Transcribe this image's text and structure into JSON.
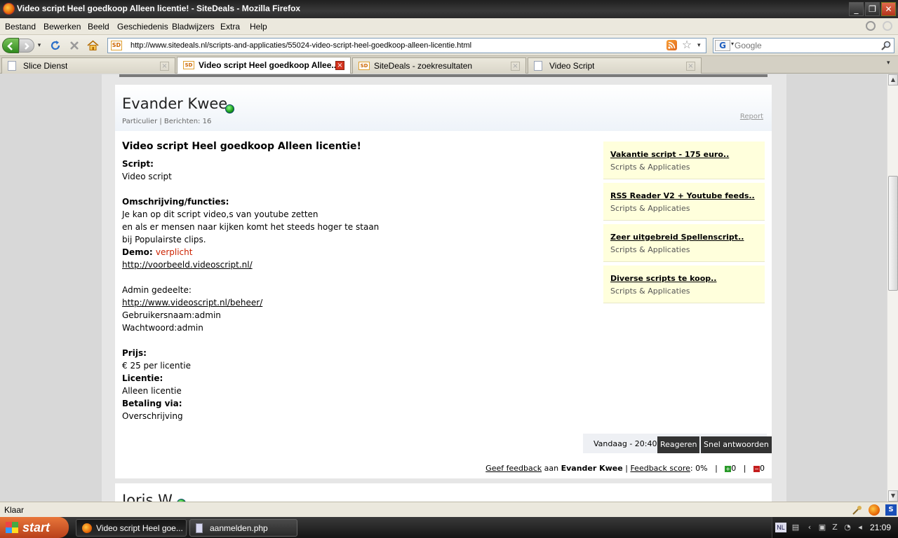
{
  "window": {
    "title": "Video script Heel goedkoop Alleen licentie! - SiteDeals - Mozilla Firefox",
    "minimize": "_",
    "maximize": "❐",
    "close": "✕"
  },
  "menu": [
    "Bestand",
    "Bewerken",
    "Beeld",
    "Geschiedenis",
    "Bladwijzers",
    "Extra",
    "Help"
  ],
  "nav": {
    "url": "http://www.sitedeals.nl/scripts-and-applicaties/55024-video-script-heel-goedkoop-alleen-licentie.html",
    "favicon_text": "SD",
    "search_engine": "G",
    "search_placeholder": "Google"
  },
  "tabs": [
    {
      "label": "Slice Dienst",
      "icon": "page-icon"
    },
    {
      "label": "Video script Heel goedkoop Allee...",
      "icon": "sitedeals-icon",
      "active": true
    },
    {
      "label": "SiteDeals - zoekresultaten",
      "icon": "sitedeals-icon"
    },
    {
      "label": "Video Script",
      "icon": "page-icon"
    }
  ],
  "post": {
    "author": "Evander Kwee",
    "meta": "Particulier | Berichten: 16",
    "report": "Report",
    "title": "Video script Heel goedkoop Alleen licentie!",
    "script_label": "Script",
    "script_value": "Video script",
    "desc_label": "Omschrijving/functies",
    "desc_lines": [
      "Je kan op dit script video,s van youtube zetten",
      "en als er mensen naar kijken komt het steeds hoger te staan",
      "bij Populairste clips."
    ],
    "demo_label": "Demo",
    "demo_value": "verplicht",
    "demo_link": "http://voorbeeld.videoscript.nl/",
    "admin_label": "Admin gedeelte:",
    "admin_link": "http://www.videoscript.nl/beheer/",
    "admin_user": "Gebruikersnaam:admin",
    "admin_pass": "Wachtwoord:admin",
    "price_label": "Prijs",
    "price_value": "€ 25 per licentie",
    "license_label": "Licentie",
    "license_value": "Alleen licentie",
    "payment_label": "Betaling via",
    "payment_value": "Overschrijving",
    "date": "Vandaag - 20:40",
    "reply_button": "Reageren",
    "quick_reply_button": "Snel antwoorden",
    "feedback_link": "Geef feedback",
    "feedback_to": "aan",
    "feedback_user": "Evander Kwee",
    "feedback_score_label": "Feedback score",
    "feedback_score": ": 0%",
    "positive_count": "0",
    "negative_count": "0",
    "separator": "|"
  },
  "related": [
    {
      "title": "Vakantie script - 175 euro..",
      "category": "Scripts & Applicaties"
    },
    {
      "title": "RSS Reader V2 + Youtube feeds..",
      "category": "Scripts & Applicaties"
    },
    {
      "title": "Zeer uitgebreid Spellenscript..",
      "category": "Scripts & Applicaties"
    },
    {
      "title": "Diverse scripts te koop..",
      "category": "Scripts & Applicaties"
    }
  ],
  "post2": {
    "author": "Joris W"
  },
  "status": "Klaar",
  "taskbar": {
    "start": "start",
    "tasks": [
      {
        "label": "Video script Heel goe...",
        "active": true
      },
      {
        "label": "aanmelden.php",
        "active": false
      }
    ],
    "language": "NL",
    "clock": "21:09"
  }
}
